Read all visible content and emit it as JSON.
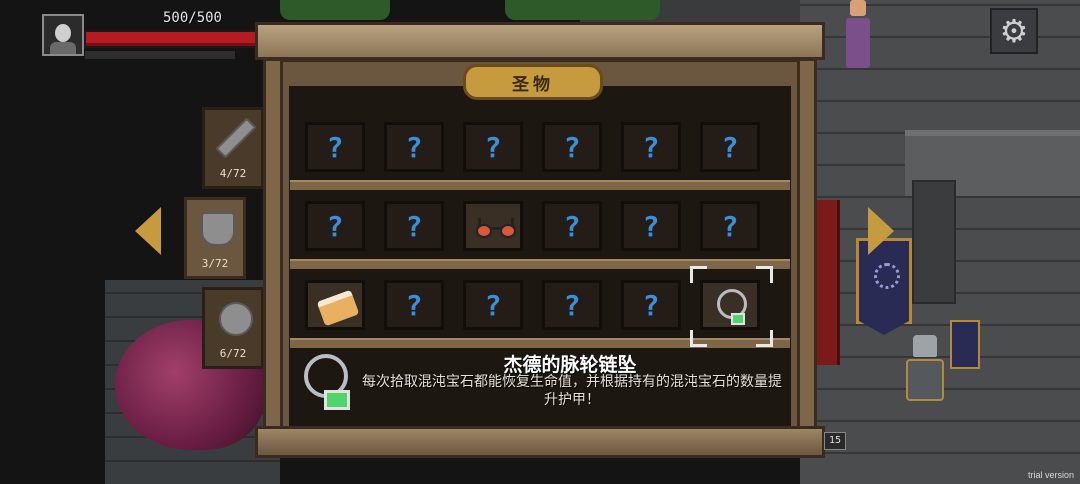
{
  "hud": {
    "hp_text": "500/500",
    "hp_fraction": 1.0
  },
  "panel": {
    "title": "圣物"
  },
  "tabs": [
    {
      "icon": "sword-icon",
      "count": "4/72"
    },
    {
      "icon": "shield-icon",
      "count": "3/72"
    },
    {
      "icon": "ring-icon",
      "count": "6/72"
    }
  ],
  "grid": {
    "unknown_symbol": "?",
    "rows": [
      [
        "unknown",
        "unknown",
        "unknown",
        "unknown",
        "unknown",
        "unknown"
      ],
      [
        "unknown",
        "unknown",
        "glasses",
        "unknown",
        "unknown",
        "unknown"
      ],
      [
        "cake",
        "unknown",
        "unknown",
        "unknown",
        "unknown",
        "pendant"
      ]
    ],
    "selected": {
      "row": 2,
      "col": 5
    }
  },
  "detail": {
    "name": "杰德的脉轮链坠",
    "description": "每次拾取混沌宝石都能恢复生命值，并根据持有的混沌宝石的数量提升护甲！"
  },
  "badge": "15",
  "watermark": "trial version",
  "colors": {
    "accent_gold": "#c69a3e",
    "unknown_blue": "#3b8fd8",
    "hp_red": "#b31d22",
    "wood": "#6b5640"
  }
}
